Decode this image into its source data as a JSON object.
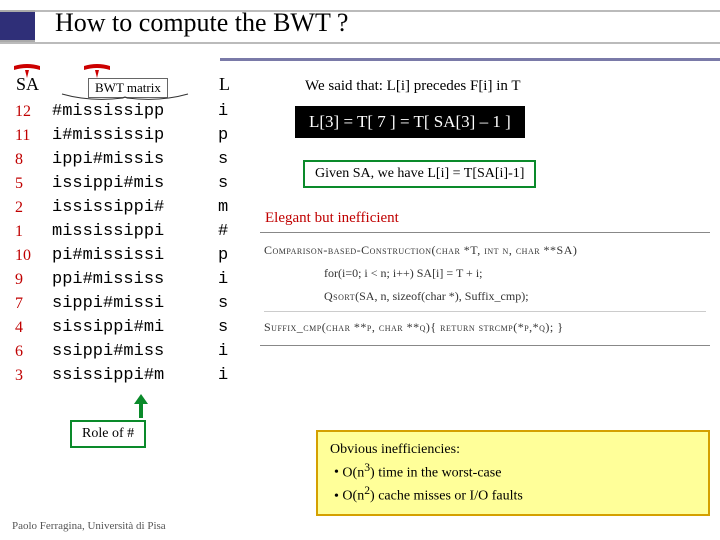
{
  "title": "How to compute the BWT ?",
  "headers": {
    "sa": "SA",
    "bwt": "BWT matrix",
    "l": "L"
  },
  "sa_values": [
    "12",
    "11",
    "8",
    "5",
    "2",
    "1",
    "10",
    "9",
    "7",
    "4",
    "6",
    "3"
  ],
  "matrix_rows": [
    "#mississipp",
    "i#mississip",
    "ippi#missis",
    "issippi#mis",
    "ississippi#",
    "mississippi",
    "pi#mississi",
    "ppi#mississ",
    "sippi#missi",
    "sissippi#mi",
    "ssippi#miss",
    "ssissippi#m"
  ],
  "l_values": [
    "i",
    "p",
    "s",
    "s",
    "m",
    "#",
    "p",
    "i",
    "s",
    "s",
    "i",
    "i"
  ],
  "we_said": "We said that: L[i] precedes F[i] in T",
  "black_box": "L[3] = T[ 7 ] = T[ SA[3] – 1 ]",
  "green_box": "Given SA, we have L[i] = T[SA[i]-1]",
  "elegant": "Elegant but inefficient",
  "code": {
    "sig": "Comparison-based-Construction(char *T, int n, char **SA)",
    "line1": "for(i=0; i < n; i++) SA[i] = T + i;",
    "line2_a": "Qsort",
    "line2_b": "(SA, n, sizeof(char *), Suffix_cmp);",
    "cmp": "Suffix_cmp(char **p, char **q){ return strcmp(*p,*q); }"
  },
  "role_label": "Role of #",
  "obvious": {
    "title": "Obvious inefficiencies:",
    "items": [
      "O(n³) time in the worst-case",
      "O(n²) cache misses or I/O faults"
    ]
  },
  "footer": "Paolo Ferragina, Università di Pisa"
}
